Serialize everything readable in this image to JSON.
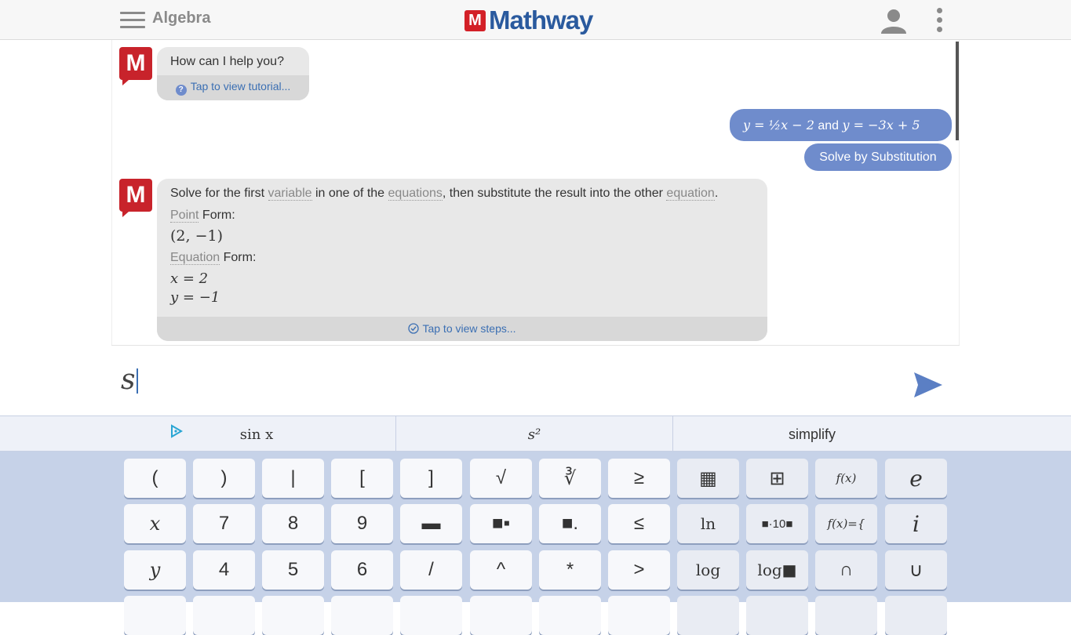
{
  "header": {
    "subject": "Algebra",
    "logo_mark": "M",
    "logo_text": "Mathway"
  },
  "chat": {
    "greeting": "How can I help you?",
    "tutorial_link": "Tap to view tutorial...",
    "user_eq_1": "y = ½x − 2",
    "user_eq_and": "and",
    "user_eq_2": "y = −3x + 5",
    "user_action": "Solve by Substitution",
    "answer": {
      "intro_1": "Solve for the first",
      "intro_term_1": "variable",
      "intro_2": "in one of the",
      "intro_term_2": "equations",
      "intro_3": ", then substitute the result into the other",
      "intro_term_3": "equation",
      "intro_4": ".",
      "point_term": "Point",
      "point_suffix": "Form:",
      "point_value": "(2, −1)",
      "equation_term": "Equation",
      "equation_suffix": "Form:",
      "eq_x": "x = 2",
      "eq_y": "y = −1",
      "steps_link": "Tap to view steps..."
    }
  },
  "input": {
    "value": "s"
  },
  "suggestions": [
    "sin x",
    "s²",
    "simplify"
  ],
  "keypad": {
    "row1": [
      "(",
      ")",
      "|",
      "[",
      "]",
      "√",
      "∛",
      "≥",
      "▦",
      "⊞",
      "f(x)",
      "e"
    ],
    "row2": [
      "x",
      "7",
      "8",
      "9",
      "▬",
      "■▪",
      "■.",
      "≤",
      "ln",
      "■·10■",
      "f(x)={",
      "i"
    ],
    "row3": [
      "y",
      "4",
      "5",
      "6",
      "/",
      "^",
      "*",
      ">",
      "log",
      "log■",
      "∩",
      "∪"
    ]
  },
  "colors": {
    "brand_red": "#c8232b",
    "brand_blue": "#2a5a9e",
    "bubble_blue": "#6f8ccc",
    "keypad_bg": "#c6d2e8"
  }
}
